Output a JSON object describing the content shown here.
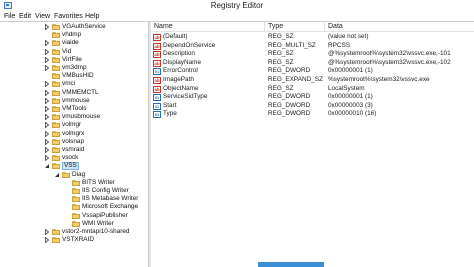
{
  "window": {
    "title": "Registry Editor"
  },
  "menu": [
    "File",
    "Edit",
    "View",
    "Favorites",
    "Help"
  ],
  "tree": {
    "selected": "VSS",
    "items": [
      {
        "label": "VGAuthService",
        "level": 0,
        "expander": "collapsed"
      },
      {
        "label": "vhdmp",
        "level": 0,
        "expander": "none"
      },
      {
        "label": "viaide",
        "level": 0,
        "expander": "collapsed"
      },
      {
        "label": "Vid",
        "level": 0,
        "expander": "collapsed"
      },
      {
        "label": "VirtFile",
        "level": 0,
        "expander": "collapsed"
      },
      {
        "label": "vm3dmp",
        "level": 0,
        "expander": "collapsed"
      },
      {
        "label": "VMBusHID",
        "level": 0,
        "expander": "none"
      },
      {
        "label": "vmci",
        "level": 0,
        "expander": "collapsed"
      },
      {
        "label": "VMMEMCTL",
        "level": 0,
        "expander": "collapsed"
      },
      {
        "label": "vmmouse",
        "level": 0,
        "expander": "collapsed"
      },
      {
        "label": "VMTools",
        "level": 0,
        "expander": "collapsed"
      },
      {
        "label": "vmusbmouse",
        "level": 0,
        "expander": "collapsed"
      },
      {
        "label": "volmgr",
        "level": 0,
        "expander": "collapsed"
      },
      {
        "label": "volmgrx",
        "level": 0,
        "expander": "collapsed"
      },
      {
        "label": "volsnap",
        "level": 0,
        "expander": "collapsed"
      },
      {
        "label": "vsmraid",
        "level": 0,
        "expander": "collapsed"
      },
      {
        "label": "vsock",
        "level": 0,
        "expander": "collapsed"
      },
      {
        "label": "VSS",
        "level": 0,
        "expander": "expanded"
      },
      {
        "label": "Diag",
        "level": 1,
        "expander": "expanded"
      },
      {
        "label": "BITS Writer",
        "level": 2,
        "expander": "none"
      },
      {
        "label": "IIS Config Writer",
        "level": 2,
        "expander": "none"
      },
      {
        "label": "IIS Metabase Writer",
        "level": 2,
        "expander": "none"
      },
      {
        "label": "Microsoft Exchange",
        "level": 2,
        "expander": "none"
      },
      {
        "label": "VssapiPublisher",
        "level": 2,
        "expander": "none"
      },
      {
        "label": "WMI Writer",
        "level": 2,
        "expander": "none"
      },
      {
        "label": "vstor2-mntapi10-shared",
        "level": 0,
        "expander": "collapsed"
      },
      {
        "label": "VSTXRAID",
        "level": 0,
        "expander": "collapsed"
      }
    ]
  },
  "columns": {
    "name": "Name",
    "type": "Type",
    "data": "Data"
  },
  "values": [
    {
      "icon": "ab",
      "name": "(Default)",
      "type": "REG_SZ",
      "data": "(value not set)"
    },
    {
      "icon": "ab",
      "name": "DependOnService",
      "type": "REG_MULTI_SZ",
      "data": "RPCSS"
    },
    {
      "icon": "ab",
      "name": "Description",
      "type": "REG_SZ",
      "data": "@%systemroot%\\system32\\vssvc.exe,-101"
    },
    {
      "icon": "ab",
      "name": "DisplayName",
      "type": "REG_SZ",
      "data": "@%systemroot%\\system32\\vssvc.exe,-102"
    },
    {
      "icon": "bin",
      "name": "ErrorControl",
      "type": "REG_DWORD",
      "data": "0x00000001 (1)"
    },
    {
      "icon": "ab",
      "name": "ImagePath",
      "type": "REG_EXPAND_SZ",
      "data": "%systemroot%\\system32\\vssvc.exe"
    },
    {
      "icon": "ab",
      "name": "ObjectName",
      "type": "REG_SZ",
      "data": "LocalSystem"
    },
    {
      "icon": "bin",
      "name": "ServiceSidType",
      "type": "REG_DWORD",
      "data": "0x00000001 (1)"
    },
    {
      "icon": "bin",
      "name": "Start",
      "type": "REG_DWORD",
      "data": "0x00000003 (3)"
    },
    {
      "icon": "bin",
      "name": "Type",
      "type": "REG_DWORD",
      "data": "0x00000010 (16)"
    }
  ],
  "icons": {
    "string_value": "string-value-icon",
    "binary_value": "binary-value-icon",
    "folder": "folder-icon",
    "app": "registry-editor-icon"
  },
  "colors": {
    "selection": "#cce4f7",
    "folder": "#f0cf6a",
    "string_icon": "#c0392b",
    "binary_icon": "#2e6db4",
    "status_block": "#3a8fd6"
  }
}
